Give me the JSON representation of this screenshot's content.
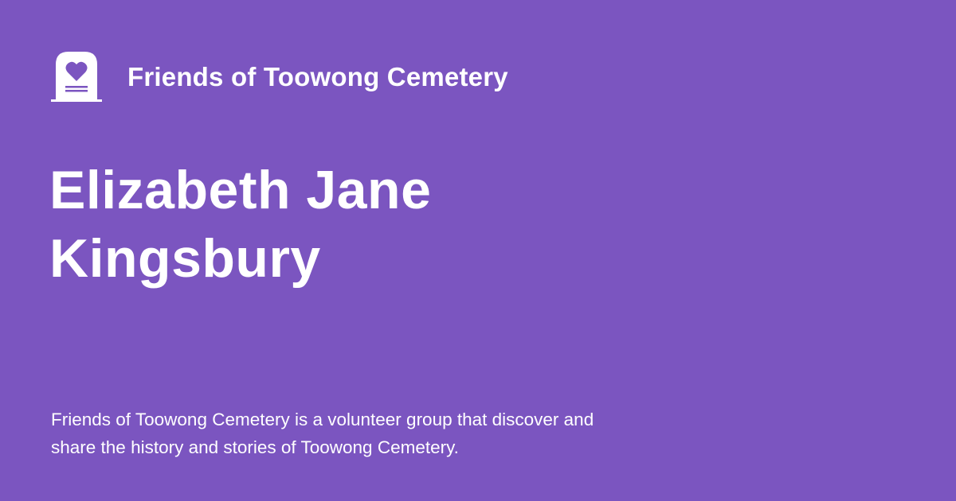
{
  "site": {
    "name": "Friends of Toowong Cemetery",
    "logo_icon": "headstone-heart-icon"
  },
  "title": {
    "line1": "Elizabeth Jane",
    "line2": "Kingsbury"
  },
  "description": {
    "line1": "Friends of Toowong Cemetery is a volunteer group that discover and",
    "line2": "share the history and stories of Toowong Cemetery."
  },
  "colors": {
    "background": "#7b55c0",
    "foreground": "#ffffff"
  }
}
